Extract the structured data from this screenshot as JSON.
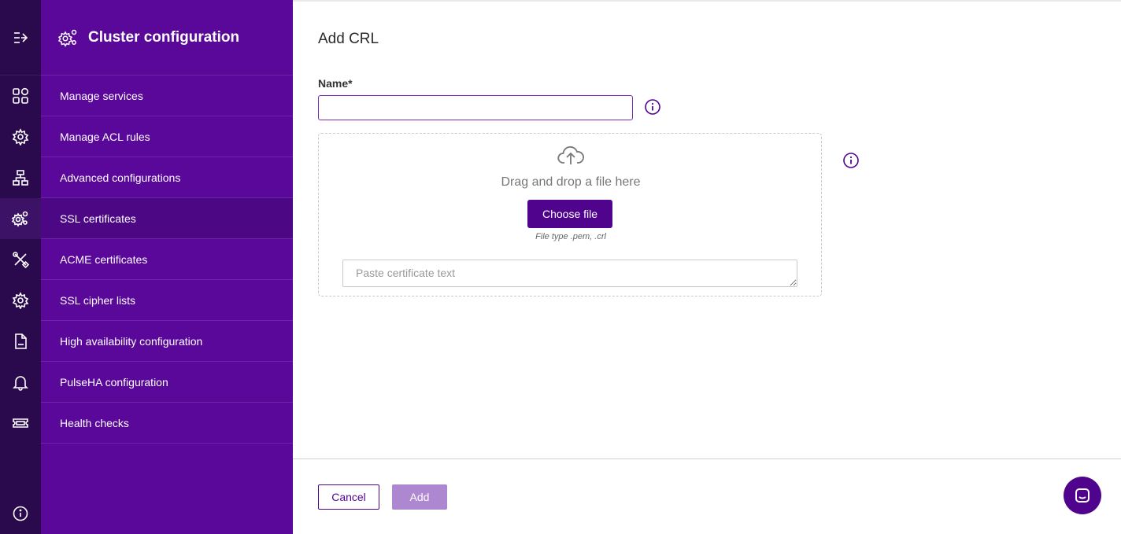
{
  "sidebar": {
    "title": "Cluster configuration",
    "header_icon": "gears-icon",
    "items": [
      {
        "label": "Manage services",
        "icon": "grid-icon"
      },
      {
        "label": "Manage ACL rules",
        "icon": "gear-network-icon"
      },
      {
        "label": "Advanced configurations",
        "icon": "hierarchy-icon"
      },
      {
        "label": "SSL certificates",
        "icon": "gears-icon",
        "active": true
      },
      {
        "label": "ACME certificates",
        "icon": "tools-icon"
      },
      {
        "label": "SSL cipher lists",
        "icon": "gear-icon"
      },
      {
        "label": "High availability configuration",
        "icon": "log-file-icon"
      },
      {
        "label": "PulseHA configuration",
        "icon": "bell-icon"
      },
      {
        "label": "Health checks",
        "icon": "ticket-icon"
      }
    ]
  },
  "form": {
    "title": "Add CRL",
    "name_label": "Name*",
    "name_value": "",
    "drop_text": "Drag and drop a file here",
    "choose_file_label": "Choose file",
    "file_type_hint": "File type .pem, .crl",
    "paste_placeholder": "Paste certificate text"
  },
  "footer": {
    "cancel_label": "Cancel",
    "add_label": "Add"
  },
  "colors": {
    "rail": "#2a0a4d",
    "sidebar": "#5a0899",
    "primary": "#50048e",
    "add_disabled": "#ad87cf"
  }
}
